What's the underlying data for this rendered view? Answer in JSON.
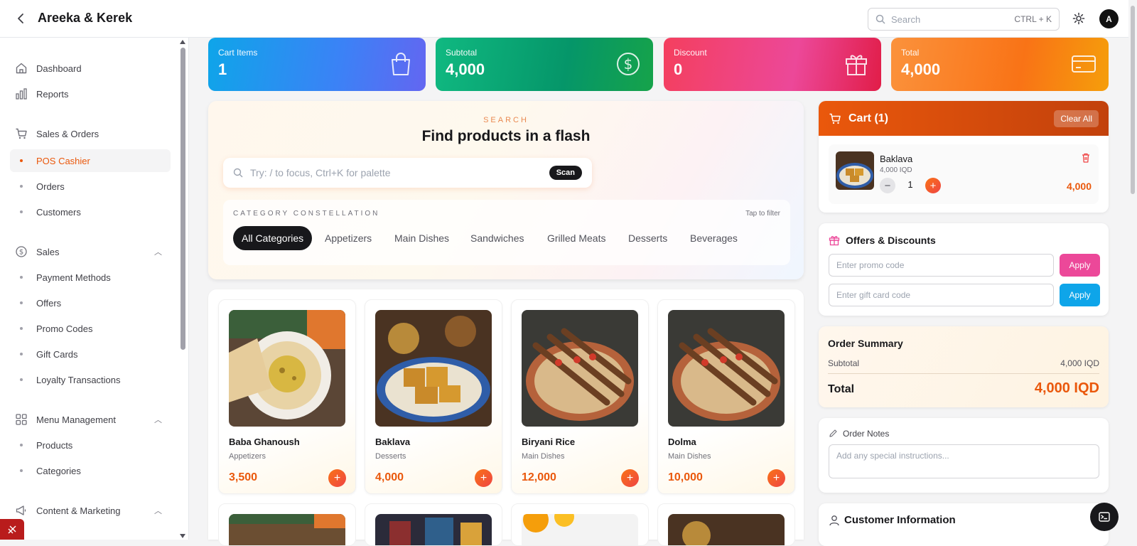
{
  "header": {
    "title": "Areeka & Kerek",
    "search_placeholder": "Search",
    "search_shortcut": "CTRL + K",
    "avatar_initial": "A"
  },
  "sidebar": {
    "items": [
      {
        "label": "Dashboard",
        "icon": "home-icon"
      },
      {
        "label": "Reports",
        "icon": "bar-chart-icon"
      },
      {
        "label": "Sales & Orders",
        "icon": "cart-icon"
      },
      {
        "label": "POS Cashier",
        "active": true
      },
      {
        "label": "Orders"
      },
      {
        "label": "Customers"
      },
      {
        "label": "Sales",
        "icon": "dollar-circle-icon"
      },
      {
        "label": "Payment Methods"
      },
      {
        "label": "Offers"
      },
      {
        "label": "Promo Codes"
      },
      {
        "label": "Gift Cards"
      },
      {
        "label": "Loyalty Transactions"
      },
      {
        "label": "Menu Management",
        "icon": "grid-icon"
      },
      {
        "label": "Products"
      },
      {
        "label": "Categories"
      },
      {
        "label": "Content & Marketing",
        "icon": "megaphone-icon"
      }
    ]
  },
  "stats": [
    {
      "label": "Cart Items",
      "value": "1",
      "icon": "bag-icon"
    },
    {
      "label": "Subtotal",
      "value": "4,000",
      "icon": "dollar-circle-icon"
    },
    {
      "label": "Discount",
      "value": "0",
      "icon": "gift-icon"
    },
    {
      "label": "Total",
      "value": "4,000",
      "icon": "credit-card-icon"
    }
  ],
  "hero": {
    "eyebrow": "SEARCH",
    "heading": "Find products in a flash",
    "search_placeholder": "Try: / to focus, Ctrl+K for palette",
    "scan_label": "Scan",
    "categories_label": "CATEGORY CONSTELLATION",
    "tap_hint": "Tap to filter",
    "categories": [
      "All Categories",
      "Appetizers",
      "Main Dishes",
      "Sandwiches",
      "Grilled Meats",
      "Desserts",
      "Beverages"
    ],
    "active_category": "All Categories"
  },
  "products": [
    {
      "name": "Baba Ghanoush",
      "category": "Appetizers",
      "price": "3,500",
      "image": "hummus-plate"
    },
    {
      "name": "Baklava",
      "category": "Desserts",
      "price": "4,000",
      "image": "baklava-plate"
    },
    {
      "name": "Biryani Rice",
      "category": "Main Dishes",
      "price": "12,000",
      "image": "kebab-skewers"
    },
    {
      "name": "Dolma",
      "category": "Main Dishes",
      "price": "10,000",
      "image": "kebab-skewers"
    }
  ],
  "cart": {
    "title": "Cart (1)",
    "clear_label": "Clear All",
    "items": [
      {
        "name": "Baklava",
        "unit_price": "4,000 IQD",
        "qty": "1",
        "line_total": "4,000"
      }
    ]
  },
  "offers": {
    "title": "Offers & Discounts",
    "promo_placeholder": "Enter promo code",
    "gift_placeholder": "Enter gift card code",
    "apply_label": "Apply",
    "colors": {
      "promo_apply": "#ec4899",
      "gift_apply": "#0ea5e9"
    }
  },
  "summary": {
    "title": "Order Summary",
    "subtotal_label": "Subtotal",
    "subtotal_value": "4,000 IQD",
    "total_label": "Total",
    "total_value": "4,000 IQD"
  },
  "notes": {
    "title": "Order Notes",
    "placeholder": "Add any special instructions..."
  },
  "customer": {
    "title": "Customer Information"
  },
  "colors": {
    "accent": "#ea580c"
  }
}
